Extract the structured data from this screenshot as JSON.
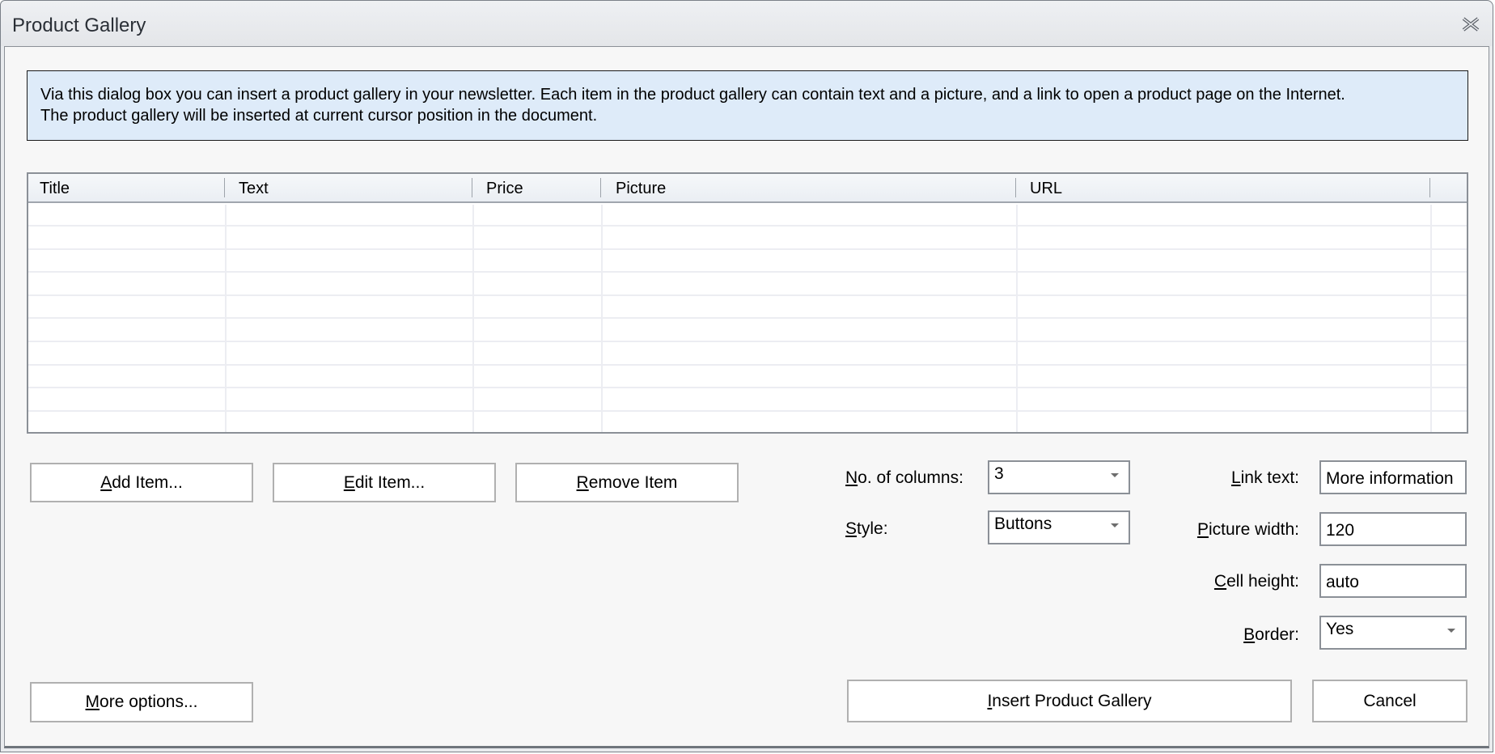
{
  "window": {
    "title": "Product Gallery",
    "close_icon": "close-x-icon"
  },
  "info": {
    "line1": "Via this dialog box you can insert a product gallery in your newsletter. Each item in the product gallery can contain text and a picture, and a link to open a product page on the Internet.",
    "line2": "The product gallery will be inserted at current cursor position in the document."
  },
  "grid": {
    "columns": [
      "Title",
      "Text",
      "Price",
      "Picture",
      "URL"
    ],
    "rows": []
  },
  "buttons": {
    "add_item": {
      "accel": "A",
      "rest": "dd Item..."
    },
    "edit_item": {
      "accel": "E",
      "rest": "dit Item..."
    },
    "remove_item": {
      "accel": "R",
      "rest": "emove Item"
    },
    "more_options": {
      "accel": "M",
      "rest": "ore options..."
    },
    "insert": {
      "accel": "I",
      "rest": "nsert Product Gallery"
    },
    "cancel": "Cancel"
  },
  "form": {
    "columns_label": {
      "accel": "N",
      "rest": "o. of columns:"
    },
    "columns_value": "3",
    "style_label": {
      "accel": "S",
      "rest": "tyle:"
    },
    "style_value": "Buttons",
    "link_text_label": {
      "accel": "L",
      "rest": "ink text:"
    },
    "link_text_value": "More information",
    "picture_width_label": {
      "accel": "P",
      "rest": "icture width:"
    },
    "picture_width_value": "120",
    "cell_height_label": {
      "accel": "C",
      "rest": "ell height:"
    },
    "cell_height_value": "auto",
    "border_label": {
      "accel": "B",
      "rest": "order:"
    },
    "border_value": "Yes"
  }
}
